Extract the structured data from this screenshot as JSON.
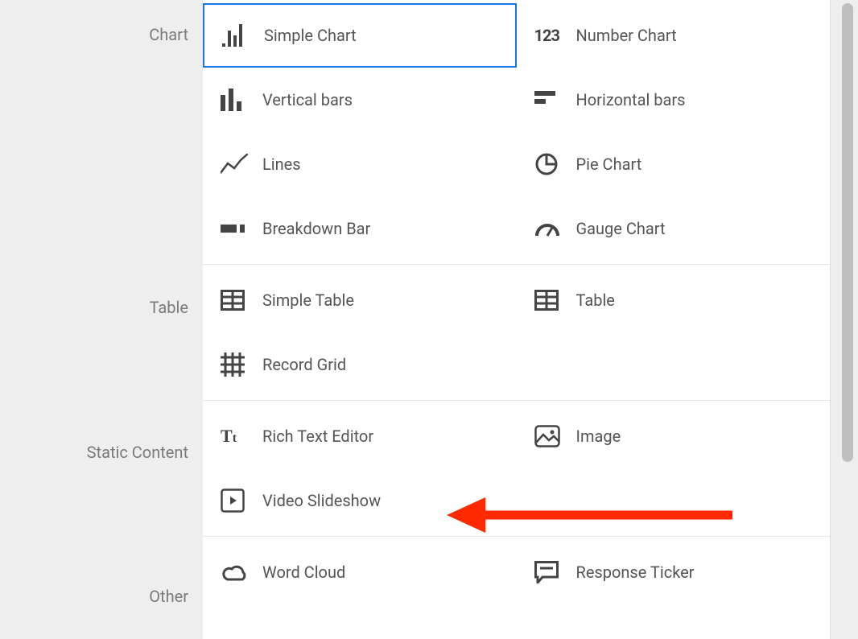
{
  "categories": {
    "chart": "Chart",
    "table": "Table",
    "static": "Static Content",
    "other": "Other"
  },
  "options": {
    "simple_chart": "Simple Chart",
    "number_chart": "Number Chart",
    "vertical_bars": "Vertical bars",
    "horizontal_bars": "Horizontal bars",
    "lines": "Lines",
    "pie_chart": "Pie Chart",
    "breakdown_bar": "Breakdown Bar",
    "gauge_chart": "Gauge Chart",
    "simple_table": "Simple Table",
    "table": "Table",
    "record_grid": "Record Grid",
    "rich_text": "Rich Text Editor",
    "image": "Image",
    "video_slideshow": "Video Slideshow",
    "word_cloud": "Word Cloud",
    "response_ticker": "Response Ticker"
  }
}
